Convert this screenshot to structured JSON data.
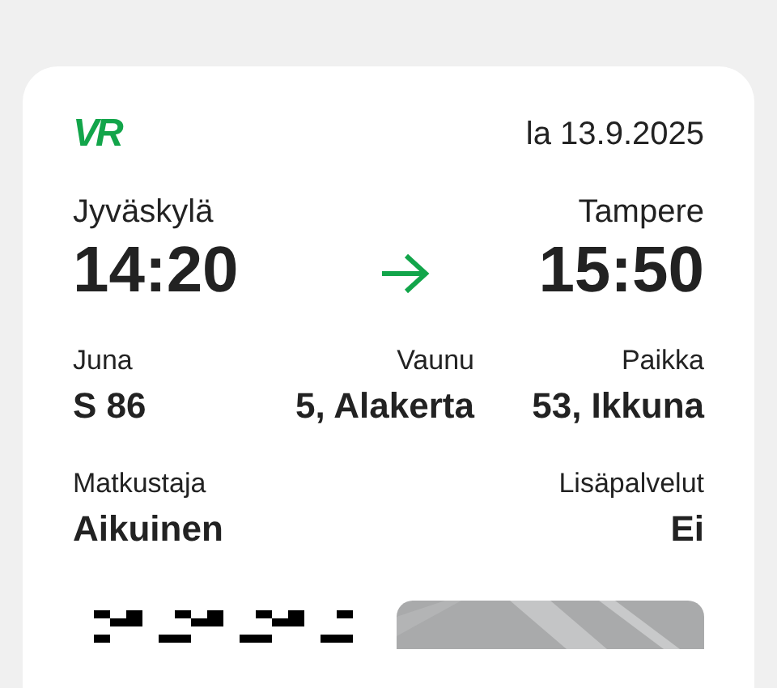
{
  "logo": {
    "text": "VR"
  },
  "date": "la 13.9.2025",
  "route": {
    "from": {
      "station": "Jyväskylä",
      "time": "14:20"
    },
    "to": {
      "station": "Tampere",
      "time": "15:50"
    }
  },
  "details": [
    {
      "label": "Juna",
      "value": "S 86"
    },
    {
      "label": "Vaunu",
      "value": "5, Alakerta"
    },
    {
      "label": "Paikka",
      "value": "53, Ikkuna"
    }
  ],
  "passenger": {
    "label": "Matkustaja",
    "value": "Aikuinen"
  },
  "extras": {
    "label": "Lisäpalvelut",
    "value": "Ei"
  }
}
